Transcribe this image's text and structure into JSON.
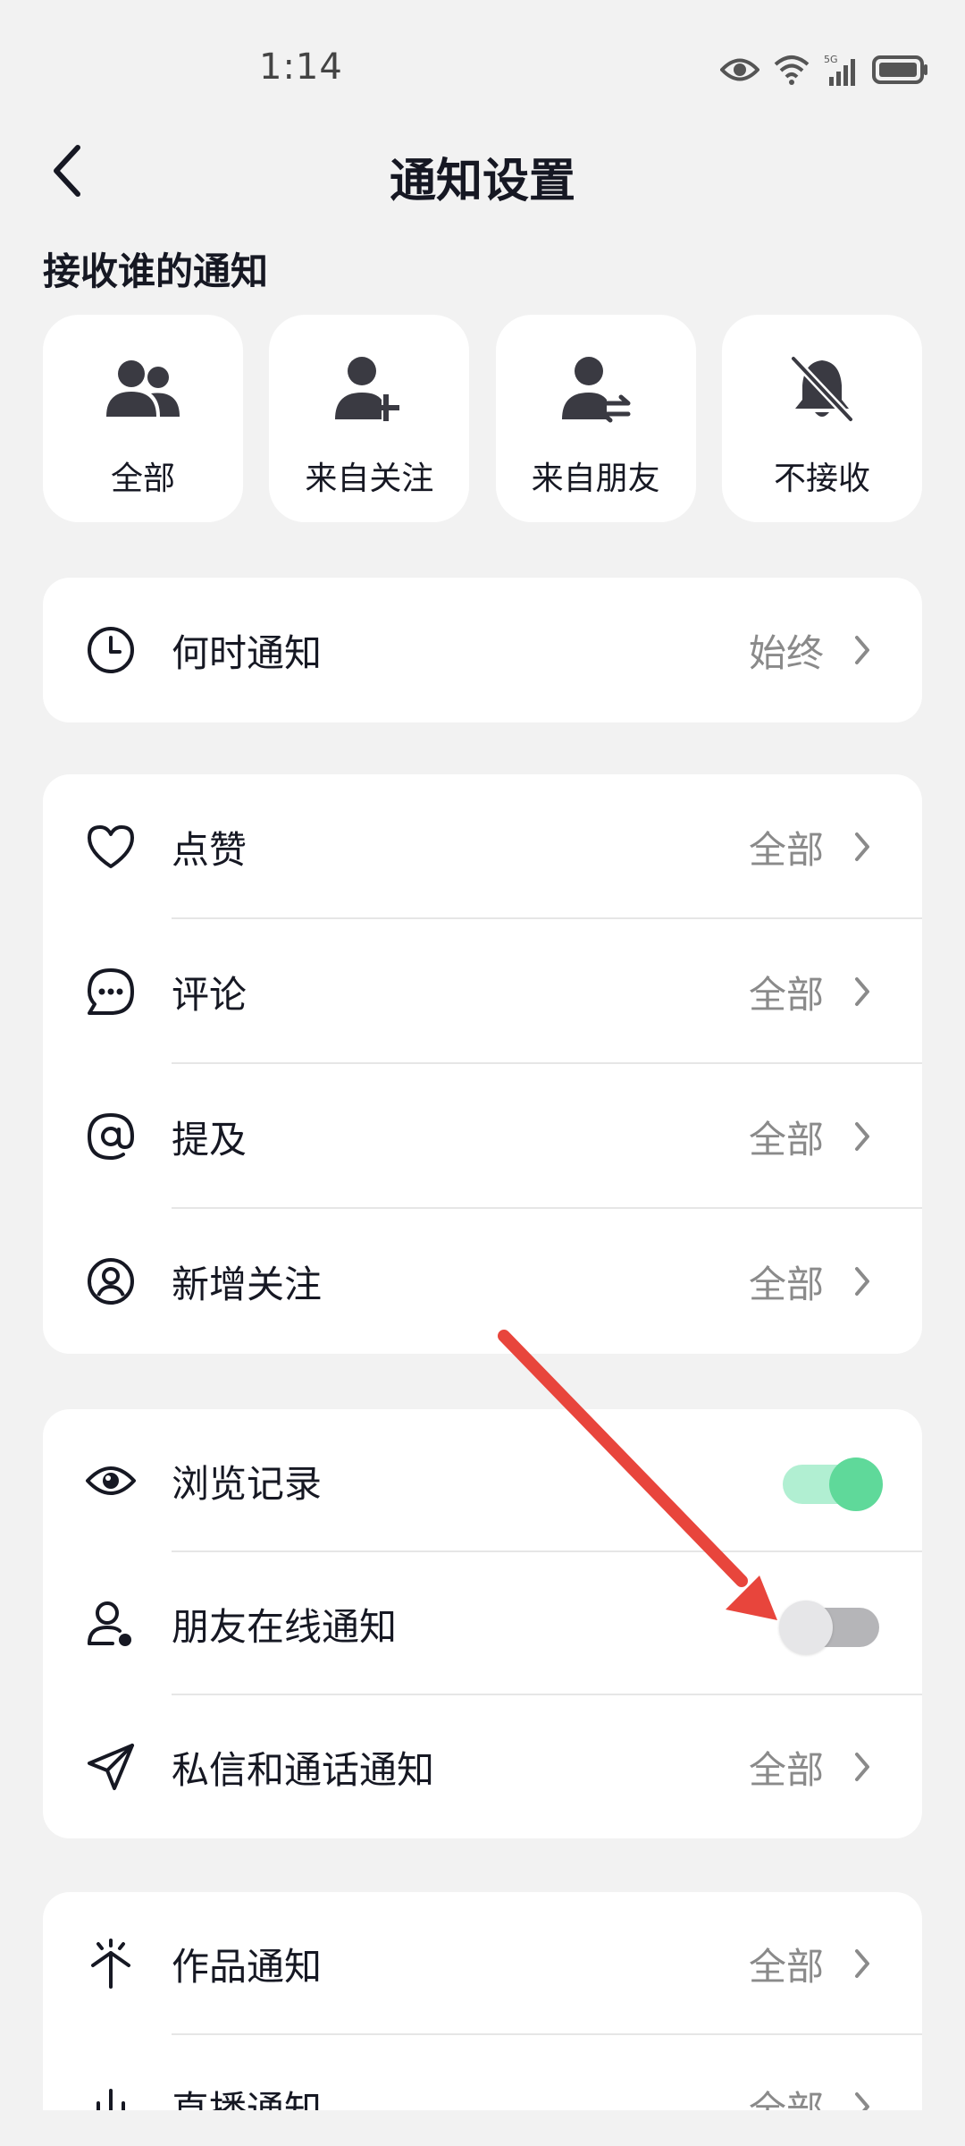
{
  "status_bar": {
    "time": "1:14",
    "network": "5G"
  },
  "header": {
    "title": "通知设置"
  },
  "receive": {
    "section_title": "接收谁的通知",
    "options": [
      {
        "label": "全部",
        "icon": "group-icon"
      },
      {
        "label": "来自关注",
        "icon": "add-user-icon"
      },
      {
        "label": "来自朋友",
        "icon": "friend-swap-icon"
      },
      {
        "label": "不接收",
        "icon": "bell-off-icon"
      }
    ]
  },
  "when": {
    "label": "何时通知",
    "value": "始终",
    "icon": "clock-icon"
  },
  "interactions": [
    {
      "label": "点赞",
      "value": "全部",
      "icon": "heart-icon"
    },
    {
      "label": "评论",
      "value": "全部",
      "icon": "comment-icon"
    },
    {
      "label": "提及",
      "value": "全部",
      "icon": "at-icon"
    },
    {
      "label": "新增关注",
      "value": "全部",
      "icon": "user-circle-icon"
    }
  ],
  "social": {
    "browse_history": {
      "label": "浏览记录",
      "enabled": true,
      "icon": "eye-icon"
    },
    "friends_online": {
      "label": "朋友在线通知",
      "enabled": false,
      "icon": "user-online-icon"
    },
    "messages": {
      "label": "私信和通话通知",
      "value": "全部",
      "icon": "send-icon"
    }
  },
  "content": [
    {
      "label": "作品通知",
      "value": "全部",
      "icon": "sparkle-icon"
    },
    {
      "label": "直播通知",
      "value": "全部",
      "icon": "live-icon"
    }
  ],
  "colors": {
    "toggle_on": "#5fd99a",
    "toggle_off": "#b5b5b8",
    "annotation_arrow": "#e8453c"
  }
}
